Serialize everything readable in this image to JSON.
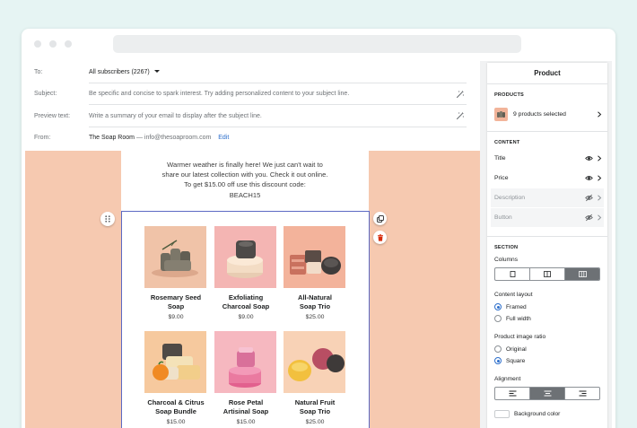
{
  "email_fields": [
    {
      "label": "To:",
      "value": "All subscribers (2267)",
      "kind": "dropdown"
    },
    {
      "label": "Subject:",
      "placeholder": "Be specific and concise to spark interest. Try adding personalized content to your subject line.",
      "kind": "input"
    },
    {
      "label": "Preview text:",
      "placeholder": "Write a summary of your email to display after the subject line.",
      "kind": "input"
    },
    {
      "label": "From:",
      "value": "The Soap Room",
      "email": "— info@thesoaproom.com",
      "action": "Edit",
      "kind": "sender"
    }
  ],
  "email_body": {
    "intro_lines": [
      "Warmer weather is finally here! We just can't wait to",
      "share our latest collection with you. Check it out online.",
      "To get $15.00 off use this discount code:",
      "BEACH15"
    ]
  },
  "products": [
    {
      "name_lines": [
        "Rosemary Seed",
        "Soap"
      ],
      "price": "$9.00"
    },
    {
      "name_lines": [
        "Exfoliating",
        "Charcoal Soap"
      ],
      "price": "$9.00"
    },
    {
      "name_lines": [
        "All-Natural",
        "Soap Trio"
      ],
      "price": "$25.00"
    },
    {
      "name_lines": [
        "Charcoal & Citrus",
        "Soap Bundle"
      ],
      "price": "$15.00"
    },
    {
      "name_lines": [
        "Rose Petal",
        "Artisinal Soap"
      ],
      "price": "$15.00"
    },
    {
      "name_lines": [
        "Natural Fruit",
        "Soap Trio"
      ],
      "price": "$25.00"
    }
  ],
  "panel": {
    "title": "Product",
    "products_heading": "PRODUCTS",
    "products_selected": "9 products selected",
    "content_heading": "CONTENT",
    "content_rows": [
      {
        "label": "Title",
        "visible": true
      },
      {
        "label": "Price",
        "visible": true
      },
      {
        "label": "Description",
        "visible": false
      },
      {
        "label": "Button",
        "visible": false
      }
    ],
    "section_heading": "SECTION",
    "columns_label": "Columns",
    "columns_selected": 3,
    "content_layout_label": "Content layout",
    "layout_options": [
      "Framed",
      "Full width"
    ],
    "layout_selected": "Framed",
    "ratio_label": "Product image ratio",
    "ratio_options": [
      "Original",
      "Square"
    ],
    "ratio_selected": "Square",
    "alignment_label": "Alignment",
    "alignment_selected": "center",
    "background_color_label": "Background color"
  },
  "colors": {
    "page_bg": "#e6f4f3",
    "email_canvas": "#f6c9b0",
    "selection_border": "#5c6ac4",
    "radio_accent": "#2c6ecb",
    "delete_red": "#d72c0d",
    "link_blue": "#2c6ecb"
  }
}
